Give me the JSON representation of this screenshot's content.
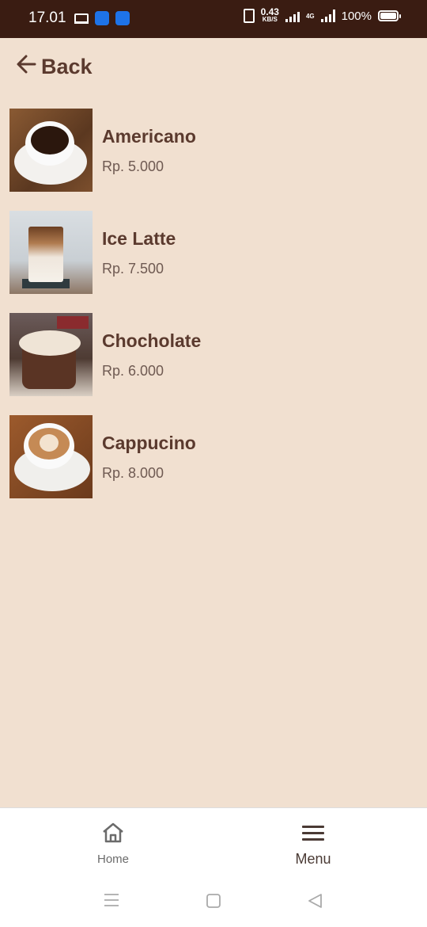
{
  "status_bar": {
    "time": "17.01",
    "net_speed_value": "0.43",
    "net_speed_unit": "KB/S",
    "network_type": "4G",
    "battery": "100%"
  },
  "header": {
    "back_label": "Back"
  },
  "menu_items": [
    {
      "name": "Americano",
      "price": "Rp. 5.000"
    },
    {
      "name": "Ice Latte",
      "price": "Rp. 7.500"
    },
    {
      "name": "Chocholate",
      "price": "Rp. 6.000"
    },
    {
      "name": "Cappucino",
      "price": "Rp. 8.000"
    }
  ],
  "bottom_nav": {
    "home_label": "Home",
    "menu_label": "Menu"
  },
  "colors": {
    "background": "#f1e0d0",
    "primary_text": "#5b3a2e",
    "status_bar": "#3a1c12"
  }
}
